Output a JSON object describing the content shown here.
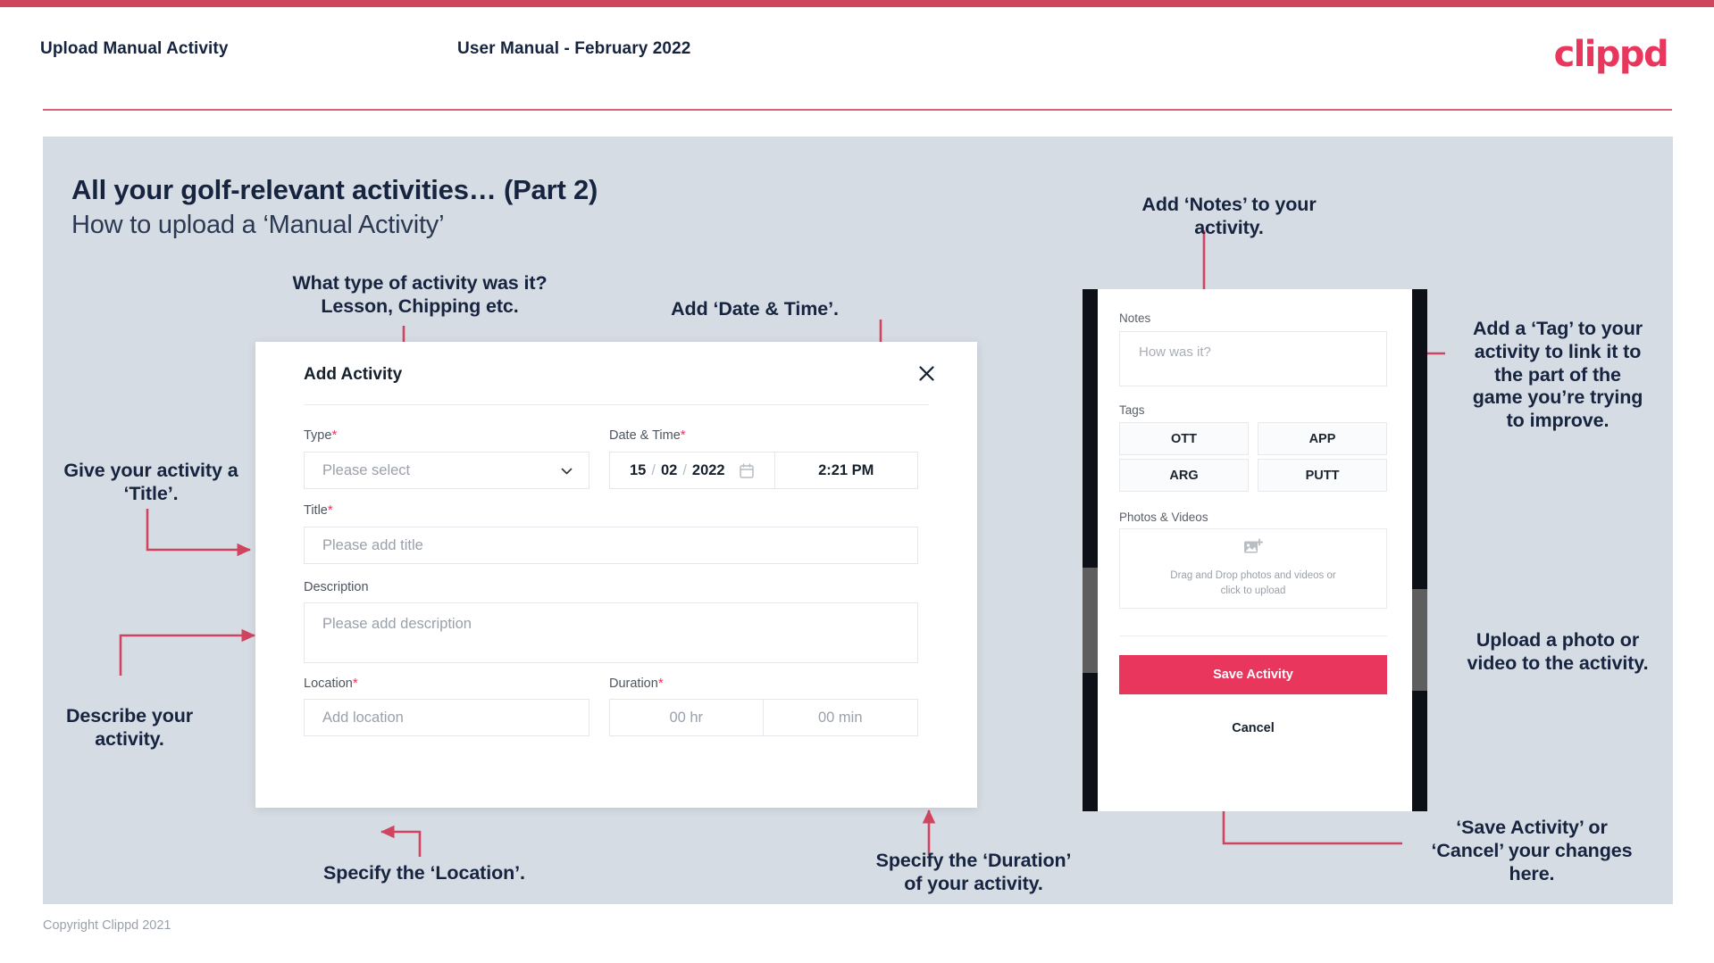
{
  "header": {
    "title": "Upload Manual Activity",
    "subtitle": "User Manual - February 2022",
    "logo": "clippd"
  },
  "slide": {
    "heading": "All your golf-relevant activities… (Part 2)",
    "subheading": "How to upload a ‘Manual Activity’"
  },
  "footer": {
    "copyright": "Copyright Clippd 2021"
  },
  "annotations": {
    "type": "What type of activity was it?\nLesson, Chipping etc.",
    "date_time": "Add ‘Date & Time’.",
    "title": "Give your activity a\n‘Title’.",
    "description": "Describe your\nactivity.",
    "location": "Specify the ‘Location’.",
    "duration": "Specify the ‘Duration’\nof your activity.",
    "notes": "Add ‘Notes’ to your\nactivity.",
    "tags": "Add a ‘Tag’ to your\nactivity to link it to\nthe part of the\ngame you’re trying\nto improve.",
    "upload": "Upload a photo or\nvideo to the activity.",
    "save_cancel": "‘Save Activity’ or\n‘Cancel’ your changes\nhere."
  },
  "modal": {
    "title": "Add Activity",
    "close_icon": "close-icon",
    "fields": {
      "type": {
        "label": "Type",
        "required": "*",
        "placeholder": "Please select",
        "value": "",
        "chevron_icon": "chevron-down-icon"
      },
      "datetime": {
        "label": "Date & Time",
        "required": "*",
        "day": "15",
        "sep1": "/",
        "month": "02",
        "sep2": "/",
        "year": "2022",
        "calendar_icon": "calendar-icon",
        "time": "2:21 PM"
      },
      "title": {
        "label": "Title",
        "required": "*",
        "placeholder": "Please add title",
        "value": ""
      },
      "description": {
        "label": "Description",
        "required": "",
        "placeholder": "Please add description",
        "value": ""
      },
      "location": {
        "label": "Location",
        "required": "*",
        "placeholder": "Add location",
        "value": ""
      },
      "duration": {
        "label": "Duration",
        "required": "*",
        "hours_placeholder": "00 hr",
        "minutes_placeholder": "00 min"
      }
    }
  },
  "phone": {
    "notes": {
      "label": "Notes",
      "placeholder": "How was it?"
    },
    "tags": {
      "label": "Tags",
      "items": [
        "OTT",
        "APP",
        "ARG",
        "PUTT"
      ]
    },
    "photos": {
      "label": "Photos & Videos",
      "icon": "add-image-icon",
      "hint_line1": "Drag and Drop photos and videos or",
      "hint_line2": "click to upload"
    },
    "save_label": "Save Activity",
    "cancel_label": "Cancel"
  },
  "colors": {
    "accent": "#e8365d",
    "accent_bar": "#cf4560",
    "panel_bg": "#d6dce4",
    "text_dark": "#16243f"
  }
}
